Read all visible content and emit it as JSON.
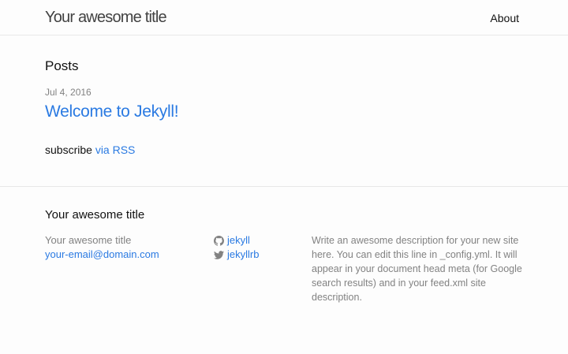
{
  "header": {
    "site_title": "Your awesome title",
    "nav": [
      {
        "label": "About"
      }
    ]
  },
  "main": {
    "heading": "Posts",
    "posts": [
      {
        "date": "Jul 4, 2016",
        "title": "Welcome to Jekyll!"
      }
    ],
    "subscribe_text": "subscribe",
    "rss_link": "via RSS"
  },
  "footer": {
    "heading": "Your awesome title",
    "col1": {
      "name": "Your awesome title",
      "email": "your-email@domain.com"
    },
    "social": [
      {
        "icon": "github-icon",
        "label": "jekyll"
      },
      {
        "icon": "twitter-icon",
        "label": "jekyllrb"
      }
    ],
    "description": "Write an awesome description for your new site here. You can edit this line in _config.yml. It will appear in your document head meta (for Google search results) and in your feed.xml site description."
  },
  "colors": {
    "link": "#2a7ae2",
    "muted": "#828282",
    "text": "#111111",
    "border": "#e8e8e8",
    "background": "#fdfdfd"
  }
}
